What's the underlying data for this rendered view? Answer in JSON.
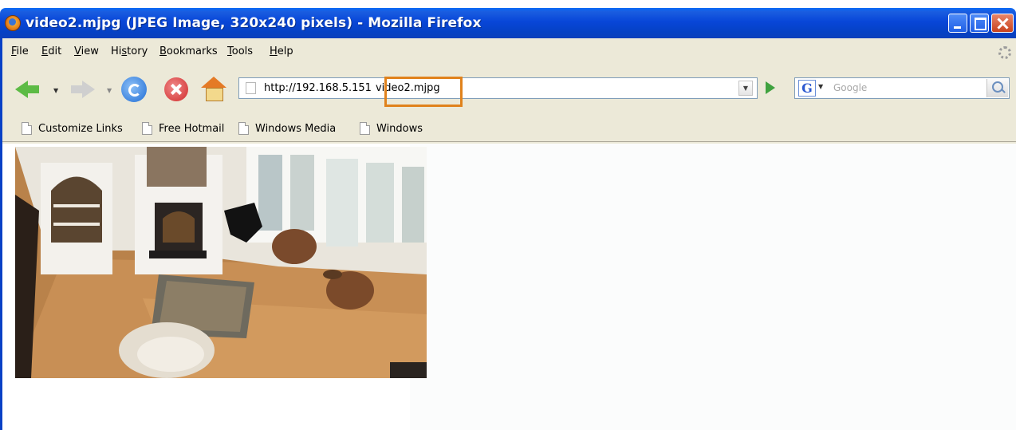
{
  "window": {
    "title": "video2.mjpg (JPEG Image, 320x240 pixels) - Mozilla Firefox"
  },
  "menu": {
    "items": [
      {
        "label": "File",
        "accel": "F",
        "rest": "ile"
      },
      {
        "label": "Edit",
        "accel": "E",
        "rest": "dit"
      },
      {
        "label": "View",
        "accel": "V",
        "rest": "iew"
      },
      {
        "label": "History",
        "pre": "Hi",
        "accel": "s",
        "rest": "tory"
      },
      {
        "label": "Bookmarks",
        "accel": "B",
        "rest": "ookmarks"
      },
      {
        "label": "Tools",
        "accel": "T",
        "rest": "ools"
      },
      {
        "label": "Help",
        "accel": "H",
        "rest": "elp"
      }
    ]
  },
  "navigation": {
    "url_prefix": "http://192.168.5.151/",
    "url_path": "video2.mjpg",
    "url_prefix_display": "http://192.168.5.151",
    "url_path_display": "video2.mjpg",
    "search_placeholder": "Google",
    "search_engine_letter": "G"
  },
  "bookmarks": {
    "items": [
      {
        "label": "Customize Links"
      },
      {
        "label": "Free Hotmail"
      },
      {
        "label": "Windows Media"
      },
      {
        "label": "Windows"
      }
    ]
  },
  "colors": {
    "titlebar": "#0846d8",
    "chrome": "#ece9d8",
    "highlight": "#e0821c"
  },
  "icons": {
    "back": "back-arrow-icon",
    "forward": "forward-arrow-icon",
    "reload": "reload-icon",
    "stop": "stop-icon",
    "home": "home-icon",
    "go": "go-icon",
    "search": "magnifier-icon"
  }
}
